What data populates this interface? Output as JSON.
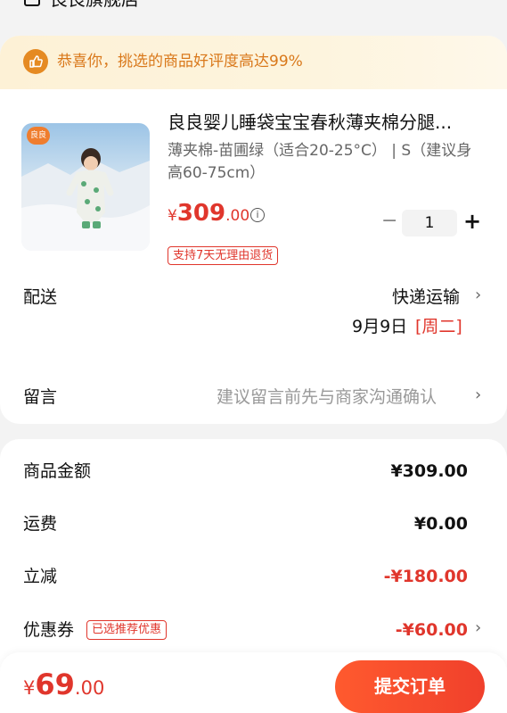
{
  "store": {
    "name": "良良旗舰店",
    "icon": "store-icon"
  },
  "banner": {
    "text": "恭喜你，挑选的商品好评度高达99%",
    "icon": "thumbs-up-icon",
    "color": "#d9781a"
  },
  "product": {
    "brand_badge": "良良",
    "title": "良良婴儿睡袋宝宝春秋薄夹棉分腿...",
    "spec": "薄夹棉-苗圃绿（适合20-25°C） | S（建议身高60-75cm）",
    "price_currency": "¥",
    "price_int": "309",
    "price_dec": ".00",
    "info_icon": "i",
    "quantity": "1",
    "minus": "−",
    "plus": "+",
    "return_tag": "支持7天无理由退货"
  },
  "delivery": {
    "label": "配送",
    "method": "快递运输",
    "date": "9月9日",
    "weekday": "[周二]"
  },
  "note": {
    "label": "留言",
    "placeholder": "建议留言前先与商家沟通确认"
  },
  "summary": {
    "subtotal_label": "商品金额",
    "subtotal_value": "¥309.00",
    "shipping_label": "运费",
    "shipping_value": "¥0.00",
    "discount_label": "立减",
    "discount_value": "-¥180.00",
    "coupon_label": "优惠券",
    "coupon_tag": "已选推荐优惠",
    "coupon_value": "-¥60.00"
  },
  "footer": {
    "total_currency": "¥",
    "total_int": "69",
    "total_dec": ".00",
    "submit_label": "提交订单"
  },
  "chevron": "›",
  "colors": {
    "accent_red": "#e0362c",
    "button_start": "#ff5a2e",
    "button_end": "#f0402c"
  }
}
